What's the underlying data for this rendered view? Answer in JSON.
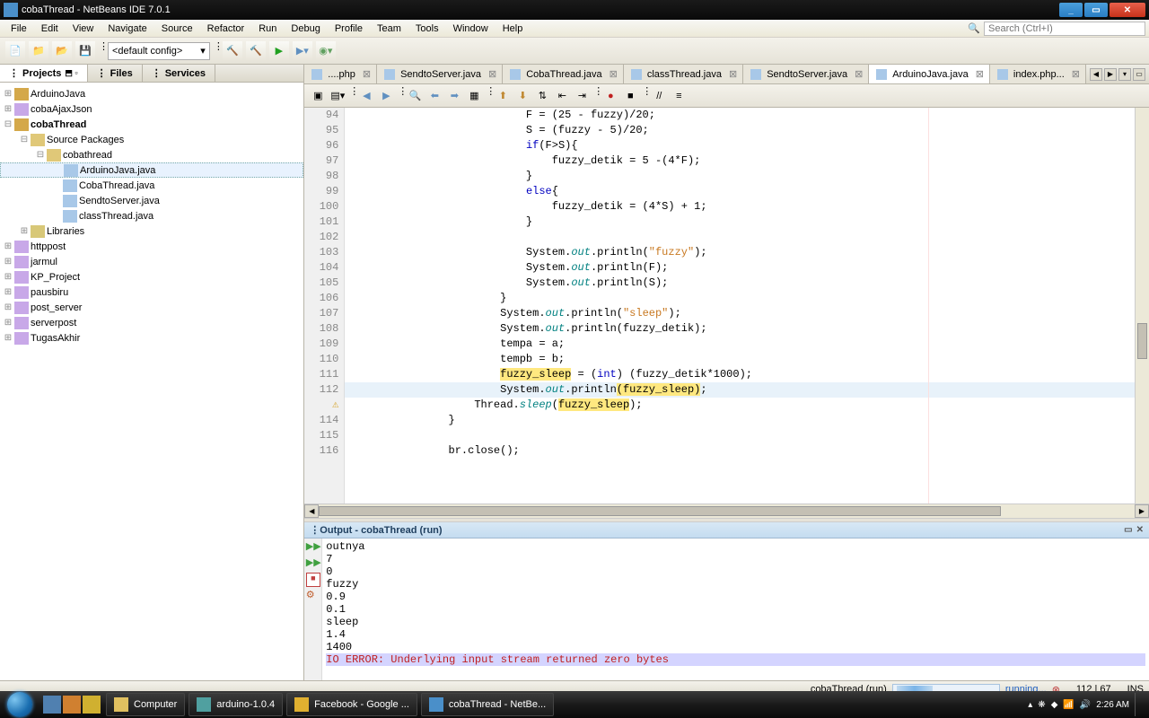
{
  "window": {
    "title": "cobaThread - NetBeans IDE 7.0.1"
  },
  "menu": [
    "File",
    "Edit",
    "View",
    "Navigate",
    "Source",
    "Refactor",
    "Run",
    "Debug",
    "Profile",
    "Team",
    "Tools",
    "Window",
    "Help"
  ],
  "search_placeholder": "Search (Ctrl+I)",
  "toolbar_combo": "<default config>",
  "panel_tabs": [
    "Projects",
    "Files",
    "Services"
  ],
  "projects": {
    "items": [
      {
        "name": "ArduinoJava",
        "depth": 0,
        "tw": "⊞",
        "icon": "proj"
      },
      {
        "name": "cobaAjaxJson",
        "depth": 0,
        "tw": "⊞",
        "icon": "php"
      },
      {
        "name": "cobaThread",
        "depth": 0,
        "tw": "⊟",
        "icon": "proj",
        "bold": true
      },
      {
        "name": "Source Packages",
        "depth": 1,
        "tw": "⊟",
        "icon": "pkg"
      },
      {
        "name": "cobathread",
        "depth": 2,
        "tw": "⊟",
        "icon": "pkg"
      },
      {
        "name": "ArduinoJava.java",
        "depth": 3,
        "tw": "",
        "icon": "java",
        "sel": true
      },
      {
        "name": "CobaThread.java",
        "depth": 3,
        "tw": "",
        "icon": "java"
      },
      {
        "name": "SendtoServer.java",
        "depth": 3,
        "tw": "",
        "icon": "java"
      },
      {
        "name": "classThread.java",
        "depth": 3,
        "tw": "",
        "icon": "java"
      },
      {
        "name": "Libraries",
        "depth": 1,
        "tw": "⊞",
        "icon": "lib"
      },
      {
        "name": "httppost",
        "depth": 0,
        "tw": "⊞",
        "icon": "php"
      },
      {
        "name": "jarmul",
        "depth": 0,
        "tw": "⊞",
        "icon": "php"
      },
      {
        "name": "KP_Project",
        "depth": 0,
        "tw": "⊞",
        "icon": "php"
      },
      {
        "name": "pausbiru",
        "depth": 0,
        "tw": "⊞",
        "icon": "php"
      },
      {
        "name": "post_server",
        "depth": 0,
        "tw": "⊞",
        "icon": "php"
      },
      {
        "name": "serverpost",
        "depth": 0,
        "tw": "⊞",
        "icon": "php"
      },
      {
        "name": "TugasAkhir",
        "depth": 0,
        "tw": "⊞",
        "icon": "php"
      }
    ]
  },
  "editor_tabs": [
    {
      "label": "....php"
    },
    {
      "label": "SendtoServer.java"
    },
    {
      "label": "CobaThread.java"
    },
    {
      "label": "classThread.java"
    },
    {
      "label": "SendtoServer.java"
    },
    {
      "label": "ArduinoJava.java",
      "active": true
    },
    {
      "label": "index.php..."
    }
  ],
  "code": {
    "first_line": 94,
    "current_line": 112,
    "lines": [
      {
        "n": 94,
        "t": "                            F = (25 - fuzzy)/20;"
      },
      {
        "n": 95,
        "t": "                            S = (fuzzy - 5)/20;"
      },
      {
        "n": 96,
        "t": "                            if(F>S){",
        "kw": [
          "if"
        ]
      },
      {
        "n": 97,
        "t": "                                fuzzy_detik = 5 -(4*F);"
      },
      {
        "n": 98,
        "t": "                            }"
      },
      {
        "n": 99,
        "t": "                            else{",
        "kw": [
          "else"
        ]
      },
      {
        "n": 100,
        "t": "                                fuzzy_detik = (4*S) + 1;"
      },
      {
        "n": 101,
        "t": "                            }"
      },
      {
        "n": 102,
        "t": ""
      },
      {
        "n": 103,
        "t": "                            System.out.println(\"fuzzy\");",
        "fld": [
          "out"
        ],
        "str": [
          "\"fuzzy\""
        ]
      },
      {
        "n": 104,
        "t": "                            System.out.println(F);",
        "fld": [
          "out"
        ]
      },
      {
        "n": 105,
        "t": "                            System.out.println(S);",
        "fld": [
          "out"
        ]
      },
      {
        "n": 106,
        "t": "                        }"
      },
      {
        "n": 107,
        "t": "                        System.out.println(\"sleep\");",
        "fld": [
          "out"
        ],
        "str": [
          "\"sleep\""
        ]
      },
      {
        "n": 108,
        "t": "                        System.out.println(fuzzy_detik);",
        "fld": [
          "out"
        ]
      },
      {
        "n": 109,
        "t": "                        tempa = a;"
      },
      {
        "n": 110,
        "t": "                        tempb = b;"
      },
      {
        "n": 111,
        "t": "                        fuzzy_sleep = (int) (fuzzy_detik*1000);",
        "kw": [
          "int"
        ],
        "hl": [
          "fuzzy_sleep"
        ]
      },
      {
        "n": 112,
        "t": "                        System.out.println(fuzzy_sleep);",
        "fld": [
          "out"
        ],
        "hl": [
          "(fuzzy_sleep)"
        ],
        "cur": true
      },
      {
        "n": "",
        "t": "                    Thread.sleep(fuzzy_sleep);",
        "fld": [
          "sleep"
        ],
        "hl": [
          "fuzzy_sleep"
        ],
        "glyph": "warn"
      },
      {
        "n": 114,
        "t": "                }"
      },
      {
        "n": 115,
        "t": ""
      },
      {
        "n": 116,
        "t": "                br.close();"
      }
    ]
  },
  "output": {
    "title": "Output - cobaThread (run)",
    "lines": [
      "outnya",
      "7",
      "0",
      "fuzzy",
      "0.9",
      "0.1",
      "sleep",
      "1.4",
      "1400"
    ],
    "error": "IO ERROR: Underlying input stream returned zero bytes"
  },
  "status": {
    "run_label": "cobaThread (run)",
    "running": "running...",
    "pos": "112 | 67",
    "mode": "INS"
  },
  "taskbar": {
    "items": [
      {
        "label": "Computer",
        "color": "#e0c060"
      },
      {
        "label": "arduino-1.0.4",
        "color": "#50a0a0"
      },
      {
        "label": "Facebook - Google ...",
        "color": "#e0b030"
      },
      {
        "label": "cobaThread - NetBe...",
        "color": "#4a8fc9"
      }
    ],
    "time": "2:26 AM"
  }
}
